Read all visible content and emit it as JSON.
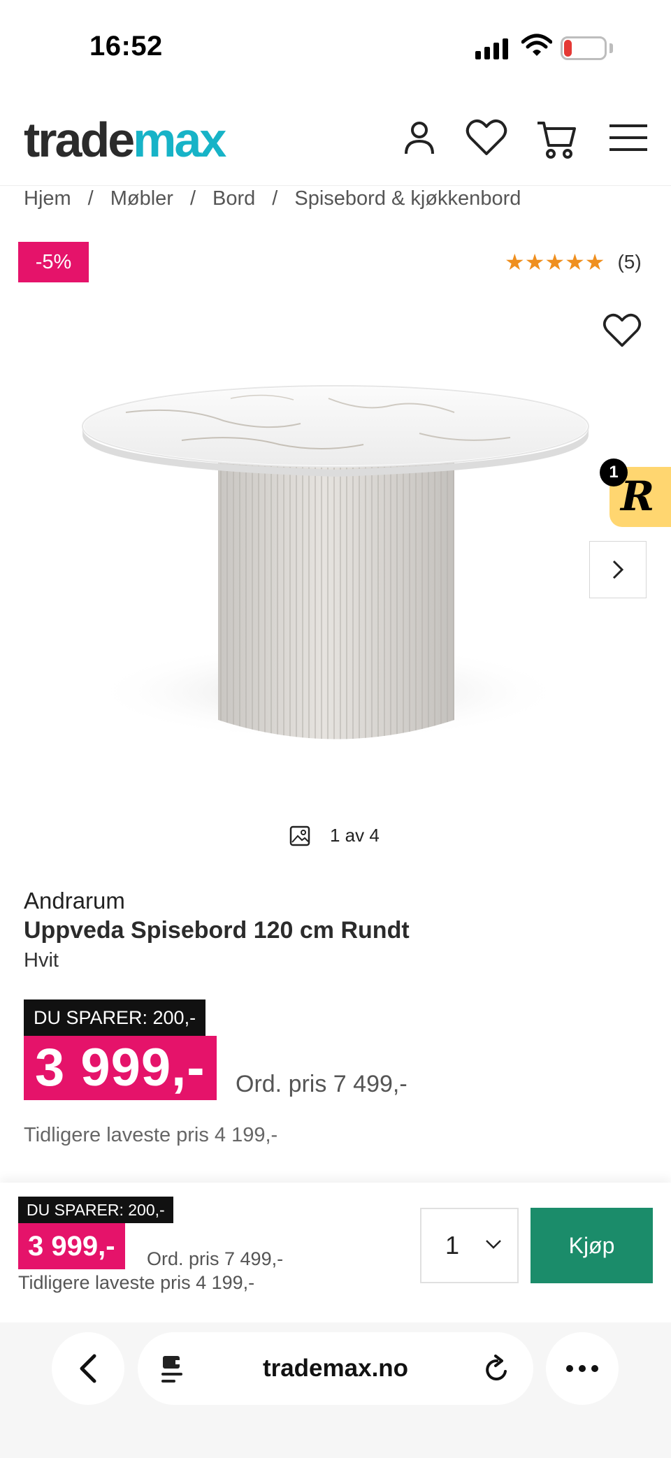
{
  "status_bar": {
    "time": "16:52",
    "battery": "18"
  },
  "header": {
    "logo_dark": "trade",
    "logo_accent": "max"
  },
  "breadcrumb": [
    "Hjem",
    "Møbler",
    "Bord",
    "Spisebord & kjøkkenbord"
  ],
  "breadcrumb_sep": "/",
  "product": {
    "discount_badge": "-5%",
    "rating_stars": "★★★★★",
    "rating_count": "(5)",
    "image_counter": "1 av 4",
    "widget_count": "1",
    "widget_letter": "R",
    "brand": "Andrarum",
    "name": "Uppveda Spisebord 120 cm Rundt",
    "variant": "Hvit",
    "save_label": "DU SPARER: 200,-",
    "price": "3 999,-",
    "ord_price": "Ord. pris 7 499,-",
    "prev_lowest": "Tidligere laveste pris 4 199,-"
  },
  "sticky": {
    "save_label": "DU SPARER: 200,-",
    "price": "3 999,-",
    "ord_price": "Ord. pris 7 499,-",
    "prev_lowest": "Tidligere laveste pris 4 199,-",
    "quantity": "1",
    "buy_label": "Kjøp"
  },
  "browser": {
    "url": "trademax.no"
  },
  "colors": {
    "accent_pink": "#e5136a",
    "buy_green": "#1b8c6a",
    "logo_teal": "#17b3c7",
    "star_orange": "#ef8f1f"
  }
}
